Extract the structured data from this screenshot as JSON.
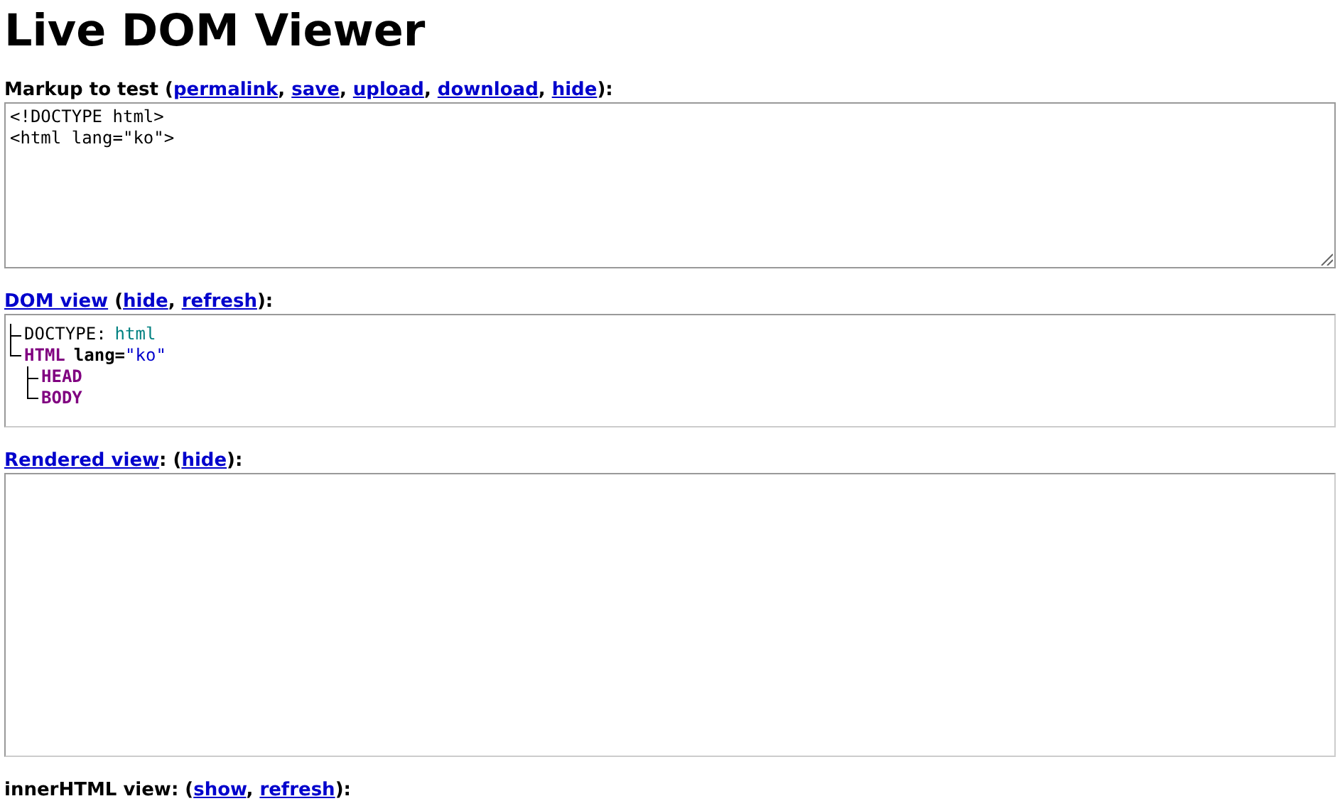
{
  "title": "Live DOM Viewer",
  "markup_section": {
    "heading": [
      {
        "kind": "text",
        "text": "Markup to test ("
      },
      {
        "kind": "link",
        "text": "permalink"
      },
      {
        "kind": "text",
        "text": ", "
      },
      {
        "kind": "link",
        "text": "save"
      },
      {
        "kind": "text",
        "text": ", "
      },
      {
        "kind": "link",
        "text": "upload"
      },
      {
        "kind": "text",
        "text": ", "
      },
      {
        "kind": "link",
        "text": "download"
      },
      {
        "kind": "text",
        "text": ", "
      },
      {
        "kind": "link",
        "text": "hide"
      },
      {
        "kind": "text",
        "text": "):"
      }
    ],
    "markup": "<!DOCTYPE html>\n<html lang=\"ko\">"
  },
  "dom_section": {
    "heading": [
      {
        "kind": "link",
        "text": "DOM view"
      },
      {
        "kind": "text",
        "text": " ("
      },
      {
        "kind": "link",
        "text": "hide"
      },
      {
        "kind": "text",
        "text": ", "
      },
      {
        "kind": "link",
        "text": "refresh"
      },
      {
        "kind": "text",
        "text": "):"
      }
    ],
    "tree": [
      {
        "kind": "doctype",
        "label": "DOCTYPE:",
        "value": "html"
      },
      {
        "kind": "element",
        "label": "HTML",
        "attributes": [
          {
            "name": "lang=",
            "value": "\"ko\""
          }
        ],
        "children": [
          {
            "kind": "element",
            "label": "HEAD"
          },
          {
            "kind": "element",
            "label": "BODY"
          }
        ]
      }
    ]
  },
  "rendered_section": {
    "heading": [
      {
        "kind": "link",
        "text": "Rendered view"
      },
      {
        "kind": "text",
        "text": ": ("
      },
      {
        "kind": "link",
        "text": "hide"
      },
      {
        "kind": "text",
        "text": "):"
      }
    ]
  },
  "inner_section": {
    "heading": [
      {
        "kind": "text",
        "text": "innerHTML view: ("
      },
      {
        "kind": "link",
        "text": "show"
      },
      {
        "kind": "text",
        "text": ", "
      },
      {
        "kind": "link",
        "text": "refresh"
      },
      {
        "kind": "text",
        "text": "):"
      }
    ]
  }
}
